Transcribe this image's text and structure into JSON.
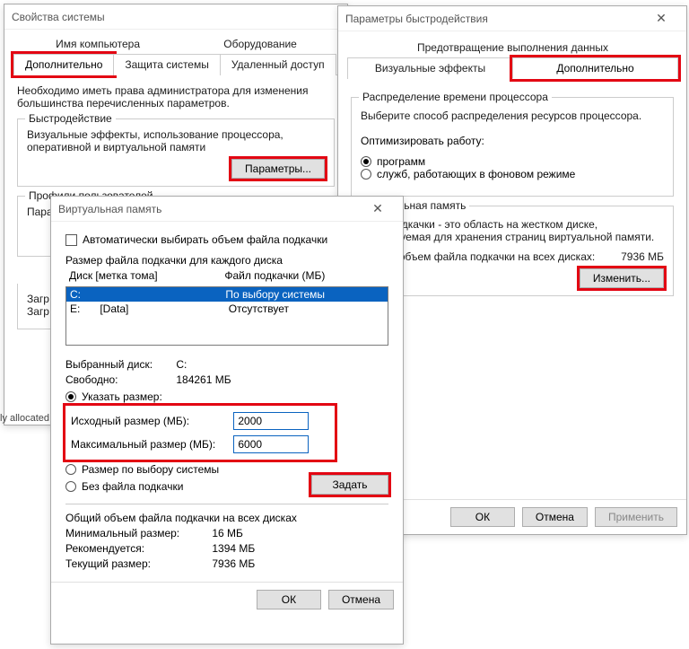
{
  "sysprops": {
    "title": "Свойства системы",
    "tabs_row1": [
      "Имя компьютера",
      "Оборудование"
    ],
    "tabs_row2": [
      "Дополнительно",
      "Защита системы",
      "Удаленный доступ"
    ],
    "admin_note": "Необходимо иметь права администратора для изменения большинства перечисленных параметров.",
    "perf_group": "Быстродействие",
    "perf_text": "Визуальные эффекты, использование процессора, оперативной и виртуальной памяти",
    "perf_btn": "Параметры...",
    "profiles_group": "Профили пользователей",
    "profiles_text": "Пара",
    "startup_group": "Загр",
    "startup_text": "Загр"
  },
  "perfopts": {
    "title": "Параметры быстродействия",
    "tabs": [
      "Визуальные эффекты",
      "Дополнительно",
      "Предотвращение выполнения данных"
    ],
    "sched_group": "Распределение времени процессора",
    "sched_text": "Выберите способ распределения ресурсов процессора.",
    "sched_opt_label": "Оптимизировать работу:",
    "sched_r1": "программ",
    "sched_r2": "служб, работающих в фоновом режиме",
    "vm_group": "Виртуальная память",
    "vm_text1": "Файл подкачки - это область на жестком диске, используемая для хранения страниц виртуальной памяти.",
    "vm_text2": "Общий объем файла подкачки на всех дисках:",
    "vm_total": "7936 МБ",
    "vm_btn": "Изменить...",
    "ok": "ОК",
    "cancel": "Отмена",
    "apply": "Применить"
  },
  "vm": {
    "title": "Виртуальная память",
    "auto_chk": "Автоматически выбирать объем файла подкачки",
    "per_drive": "Размер файла подкачки для каждого диска",
    "hdr_drive": "Диск [метка тома]",
    "hdr_pf": "Файл подкачки (МБ)",
    "row_c_drv": "C:",
    "row_c_pf": "По выбору системы",
    "row_e_drv": "E:",
    "row_e_lbl": "[Data]",
    "row_e_pf": "Отсутствует",
    "sel_drive_lbl": "Выбранный диск:",
    "sel_drive_val": "C:",
    "free_lbl": "Свободно:",
    "free_val": "184261 МБ",
    "r_custom": "Указать размер:",
    "init_lbl": "Исходный размер (МБ):",
    "init_val": "2000",
    "max_lbl": "Максимальный размер (МБ):",
    "max_val": "6000",
    "r_sys": "Размер по выбору системы",
    "r_none": "Без файла подкачки",
    "set_btn": "Задать",
    "total_group": "Общий объем файла подкачки на всех дисках",
    "min_lbl": "Минимальный размер:",
    "min_val": "16 МБ",
    "rec_lbl": "Рекомендуется:",
    "rec_val": "1394 МБ",
    "cur_lbl": "Текущий размер:",
    "cur_val": "7936 МБ",
    "ok": "ОК",
    "cancel": "Отмена"
  },
  "misc": {
    "fly": "ly allocated"
  }
}
